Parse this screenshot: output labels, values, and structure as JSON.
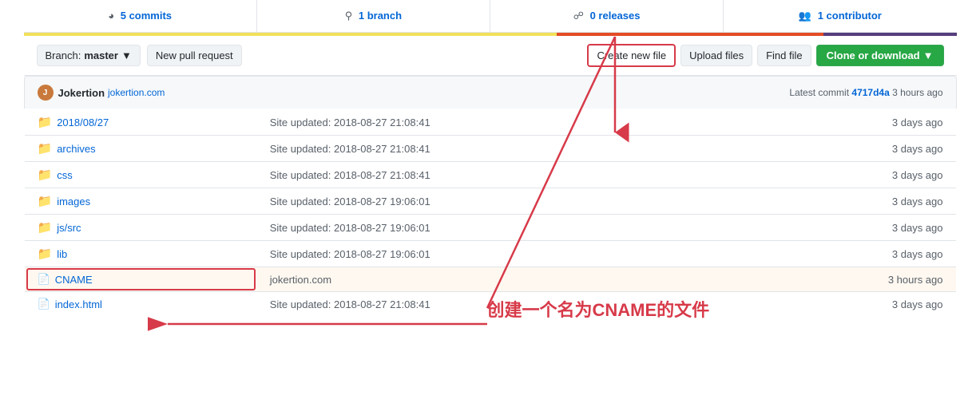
{
  "topbar": {
    "commits": {
      "count": "5",
      "label": "commits"
    },
    "branch": {
      "count": "1",
      "label": "branch"
    },
    "releases": {
      "count": "0",
      "label": "releases"
    },
    "contributors": {
      "count": "1",
      "label": "contributor"
    }
  },
  "toolbar": {
    "branch_label": "Branch:",
    "branch_name": "master",
    "new_pull_request": "New pull request",
    "create_new_file": "Create new file",
    "upload_files": "Upload files",
    "find_file": "Find file",
    "clone_or_download": "Clone or download"
  },
  "commit_info": {
    "username": "Jokertion",
    "userlink": "jokertion.com",
    "message": "Latest commit",
    "hash": "4717d4a",
    "time": "3 hours ago"
  },
  "files": [
    {
      "name": "2018/08/27",
      "type": "folder",
      "commit": "Site updated: 2018-08-27 21:08:41",
      "time": "3 days ago"
    },
    {
      "name": "archives",
      "type": "folder",
      "commit": "Site updated: 2018-08-27 21:08:41",
      "time": "3 days ago"
    },
    {
      "name": "css",
      "type": "folder",
      "commit": "Site updated: 2018-08-27 21:08:41",
      "time": "3 days ago"
    },
    {
      "name": "images",
      "type": "folder",
      "commit": "Site updated: 2018-08-27 19:06:01",
      "time": "3 days ago"
    },
    {
      "name": "js/src",
      "type": "folder",
      "commit": "Site updated: 2018-08-27 19:06:01",
      "time": "3 days ago"
    },
    {
      "name": "lib",
      "type": "folder",
      "commit": "Site updated: 2018-08-27 19:06:01",
      "time": "3 days ago"
    },
    {
      "name": "CNAME",
      "type": "file",
      "commit": "jokertion.com",
      "time": "3 hours ago",
      "highlight": true
    },
    {
      "name": "index.html",
      "type": "file",
      "commit": "Site updated: 2018-08-27 21:08:41",
      "time": "3 days ago"
    }
  ],
  "annotation": {
    "text": "创建一个名为CNAME的文件"
  }
}
